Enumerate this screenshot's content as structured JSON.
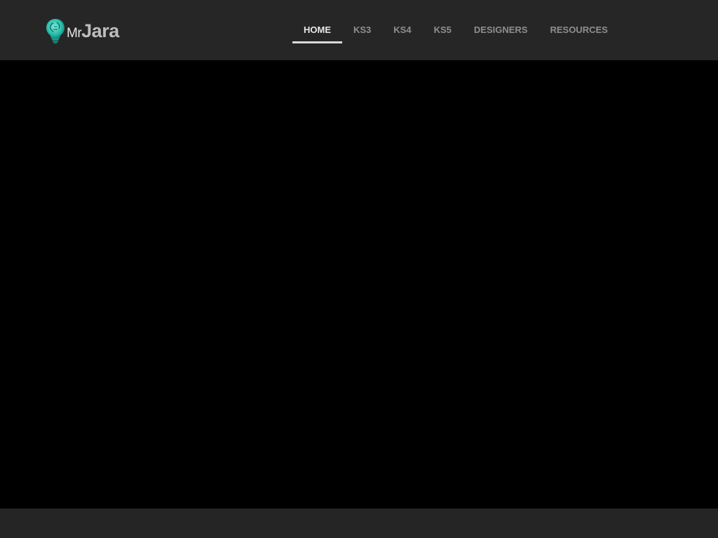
{
  "brand": {
    "prefix": "Mr",
    "name": "Jara",
    "logo_icon": "lightbulb-head-icon",
    "accent_color": "#2ec4b0"
  },
  "nav": {
    "items": [
      {
        "label": "HOME",
        "active": true
      },
      {
        "label": "KS3",
        "active": false
      },
      {
        "label": "KS4",
        "active": false
      },
      {
        "label": "KS5",
        "active": false
      },
      {
        "label": "DESIGNERS",
        "active": false
      },
      {
        "label": "RESOURCES",
        "active": false
      }
    ]
  },
  "colors": {
    "header_bg": "#262626",
    "hero_bg": "#000000",
    "nav_active": "#e8e8e8",
    "nav_inactive": "#8f8f8f"
  }
}
